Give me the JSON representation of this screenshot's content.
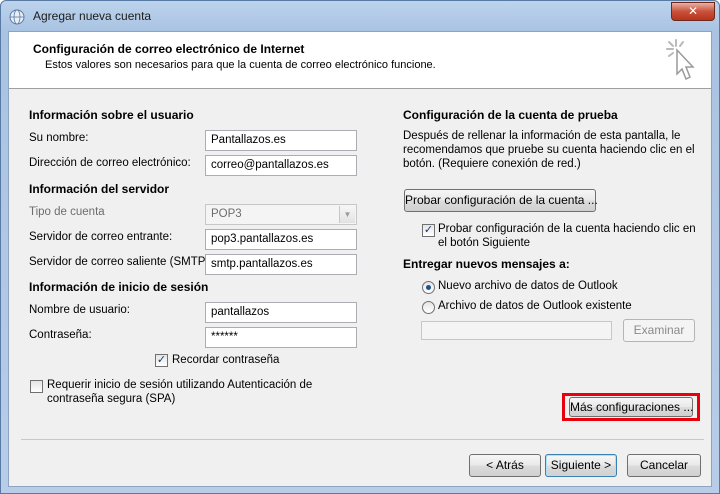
{
  "window": {
    "title": "Agregar nueva cuenta",
    "close_label": "✕"
  },
  "header": {
    "title": "Configuración de correo electrónico de Internet",
    "subtitle": "Estos valores son necesarios para que la cuenta de correo electrónico funcione."
  },
  "user_info": {
    "heading": "Información sobre el usuario",
    "name_label": "Su nombre:",
    "name_value": "Pantallazos.es",
    "email_label": "Dirección de correo electrónico:",
    "email_value": "correo@pantallazos.es"
  },
  "server_info": {
    "heading": "Información del servidor",
    "account_type_label": "Tipo de cuenta",
    "account_type_value": "POP3",
    "incoming_label": "Servidor de correo entrante:",
    "incoming_value": "pop3.pantallazos.es",
    "outgoing_label": "Servidor de correo saliente (SMTP):",
    "outgoing_value": "smtp.pantallazos.es"
  },
  "logon_info": {
    "heading": "Información de inicio de sesión",
    "username_label": "Nombre de usuario:",
    "username_value": "pantallazos",
    "password_label": "Contraseña:",
    "password_value": "******",
    "remember_label": "Recordar contraseña",
    "remember_checked": true,
    "spa_label_line1": "Requerir inicio de sesión utilizando Autenticación de",
    "spa_label_line2": "contraseña segura (SPA)",
    "spa_checked": false
  },
  "test_settings": {
    "heading": "Configuración de la cuenta de prueba",
    "description_line1": "Después de rellenar la información de esta pantalla, le",
    "description_line2": "recomendamos que pruebe su cuenta haciendo clic en el",
    "description_line3": "botón. (Requiere conexión de red.)",
    "test_button": "Probar configuración de la cuenta ...",
    "auto_test_label_line1": "Probar configuración de la cuenta haciendo clic en",
    "auto_test_label_line2": "el botón Siguiente",
    "auto_test_checked": true
  },
  "deliver": {
    "heading": "Entregar nuevos mensajes a:",
    "option_new": "Nuevo archivo de datos de Outlook",
    "option_existing": "Archivo de datos de Outlook existente",
    "selected": "new",
    "existing_path": "",
    "browse_button": "Examinar"
  },
  "more_settings_button": "Más configuraciones ...",
  "highlight_color": "#e8000b",
  "footer": {
    "back_button": "< Atrás",
    "next_button": "Siguiente >",
    "cancel_button": "Cancelar"
  }
}
